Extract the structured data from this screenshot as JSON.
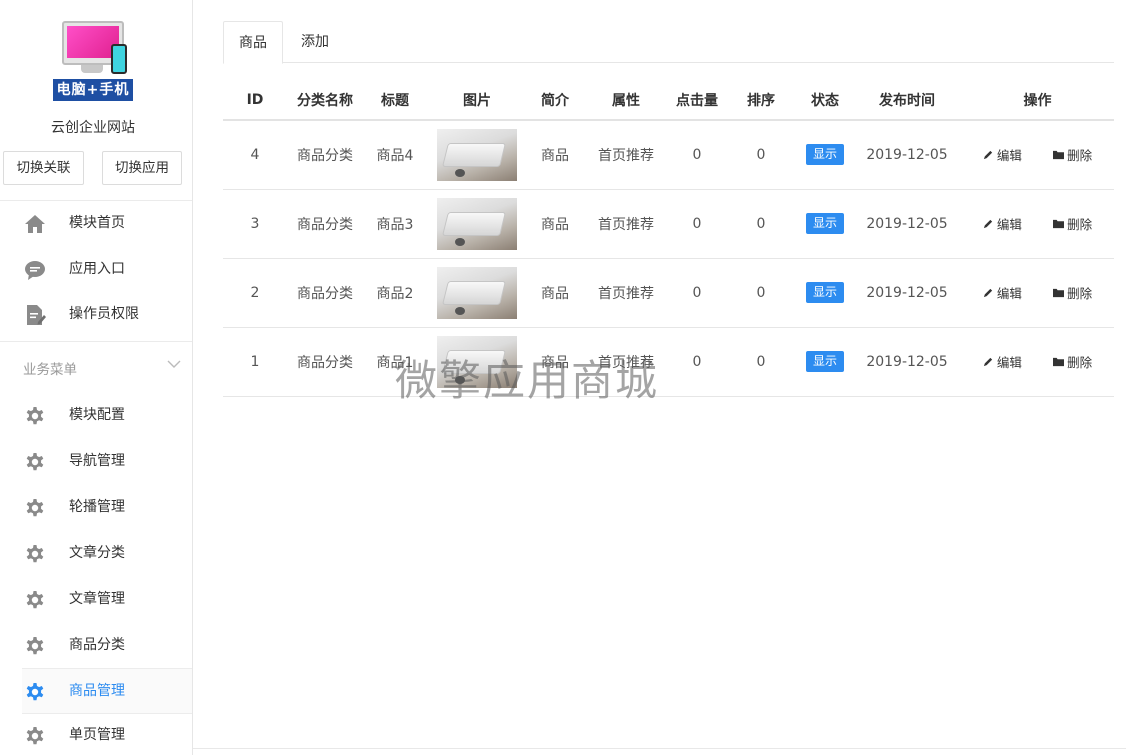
{
  "sidebar": {
    "logo_text": "电脑+手机",
    "site_name": "云创企业网站",
    "switch_buttons": [
      "切换关联",
      "切换应用"
    ],
    "top_items": [
      {
        "label": "模块首页",
        "icon": "home-icon"
      },
      {
        "label": "应用入口",
        "icon": "chat-icon"
      },
      {
        "label": "操作员权限",
        "icon": "document-edit-icon"
      }
    ],
    "section_label": "业务菜单",
    "menu_items": [
      {
        "label": "模块配置",
        "icon": "gear-icon"
      },
      {
        "label": "导航管理",
        "icon": "gear-icon"
      },
      {
        "label": "轮播管理",
        "icon": "gear-icon"
      },
      {
        "label": "文章分类",
        "icon": "gear-icon"
      },
      {
        "label": "文章管理",
        "icon": "gear-icon"
      },
      {
        "label": "商品分类",
        "icon": "gear-icon"
      },
      {
        "label": "商品管理",
        "icon": "gear-icon",
        "active": true
      },
      {
        "label": "单页管理",
        "icon": "gear-icon"
      }
    ]
  },
  "tabs": [
    "商品",
    "添加"
  ],
  "table": {
    "headers": [
      "ID",
      "分类名称",
      "标题",
      "图片",
      "简介",
      "属性",
      "点击量",
      "排序",
      "状态",
      "发布时间",
      "操作"
    ],
    "rows": [
      {
        "id": "4",
        "category": "商品分类",
        "title": "商品4",
        "intro": "商品",
        "attr": "首页推荐",
        "clicks": "0",
        "sort": "0",
        "status": "显示",
        "date": "2019-12-05"
      },
      {
        "id": "3",
        "category": "商品分类",
        "title": "商品3",
        "intro": "商品",
        "attr": "首页推荐",
        "clicks": "0",
        "sort": "0",
        "status": "显示",
        "date": "2019-12-05"
      },
      {
        "id": "2",
        "category": "商品分类",
        "title": "商品2",
        "intro": "商品",
        "attr": "首页推荐",
        "clicks": "0",
        "sort": "0",
        "status": "显示",
        "date": "2019-12-05"
      },
      {
        "id": "1",
        "category": "商品分类",
        "title": "商品1",
        "intro": "商品",
        "attr": "首页推荐",
        "clicks": "0",
        "sort": "0",
        "status": "显示",
        "date": "2019-12-05"
      }
    ],
    "edit_label": "编辑",
    "delete_label": "删除"
  },
  "watermark": "微擎应用商城",
  "colors": {
    "accent": "#2d8cf0",
    "icon_gray": "#8a8a8a"
  }
}
